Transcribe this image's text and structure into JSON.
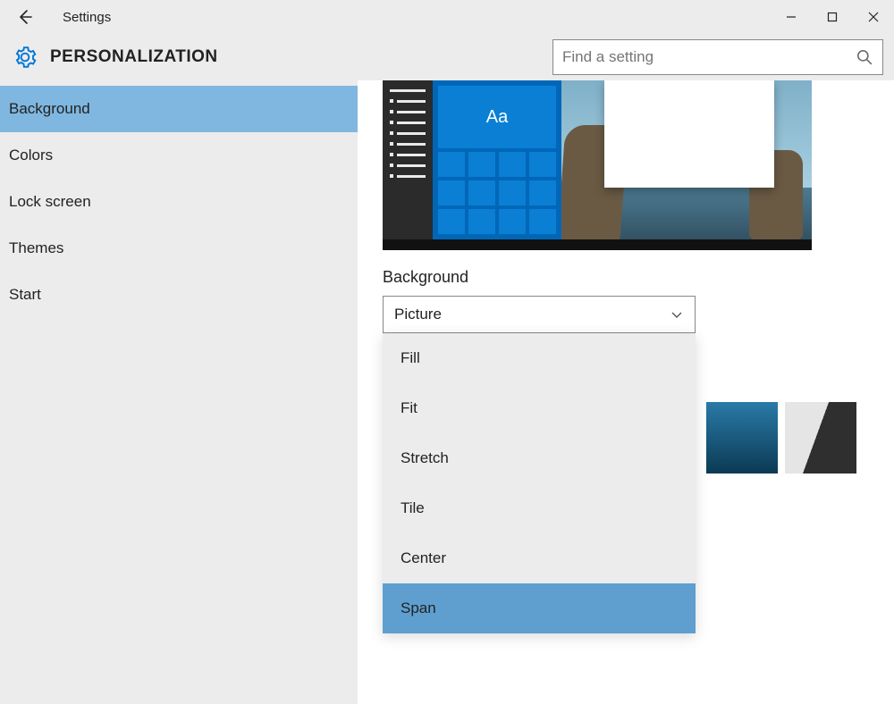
{
  "titlebar": {
    "app_title": "Settings"
  },
  "header": {
    "section_title": "PERSONALIZATION"
  },
  "search": {
    "placeholder": "Find a setting"
  },
  "sidebar": {
    "items": [
      {
        "label": "Background",
        "active": true
      },
      {
        "label": "Colors",
        "active": false
      },
      {
        "label": "Lock screen",
        "active": false
      },
      {
        "label": "Themes",
        "active": false
      },
      {
        "label": "Start",
        "active": false
      }
    ]
  },
  "main": {
    "preview_tile_text": "Aa",
    "background_label": "Background",
    "background_select": {
      "value": "Picture"
    },
    "fit_dropdown": {
      "options": [
        "Fill",
        "Fit",
        "Stretch",
        "Tile",
        "Center",
        "Span"
      ],
      "selected": "Span"
    }
  }
}
